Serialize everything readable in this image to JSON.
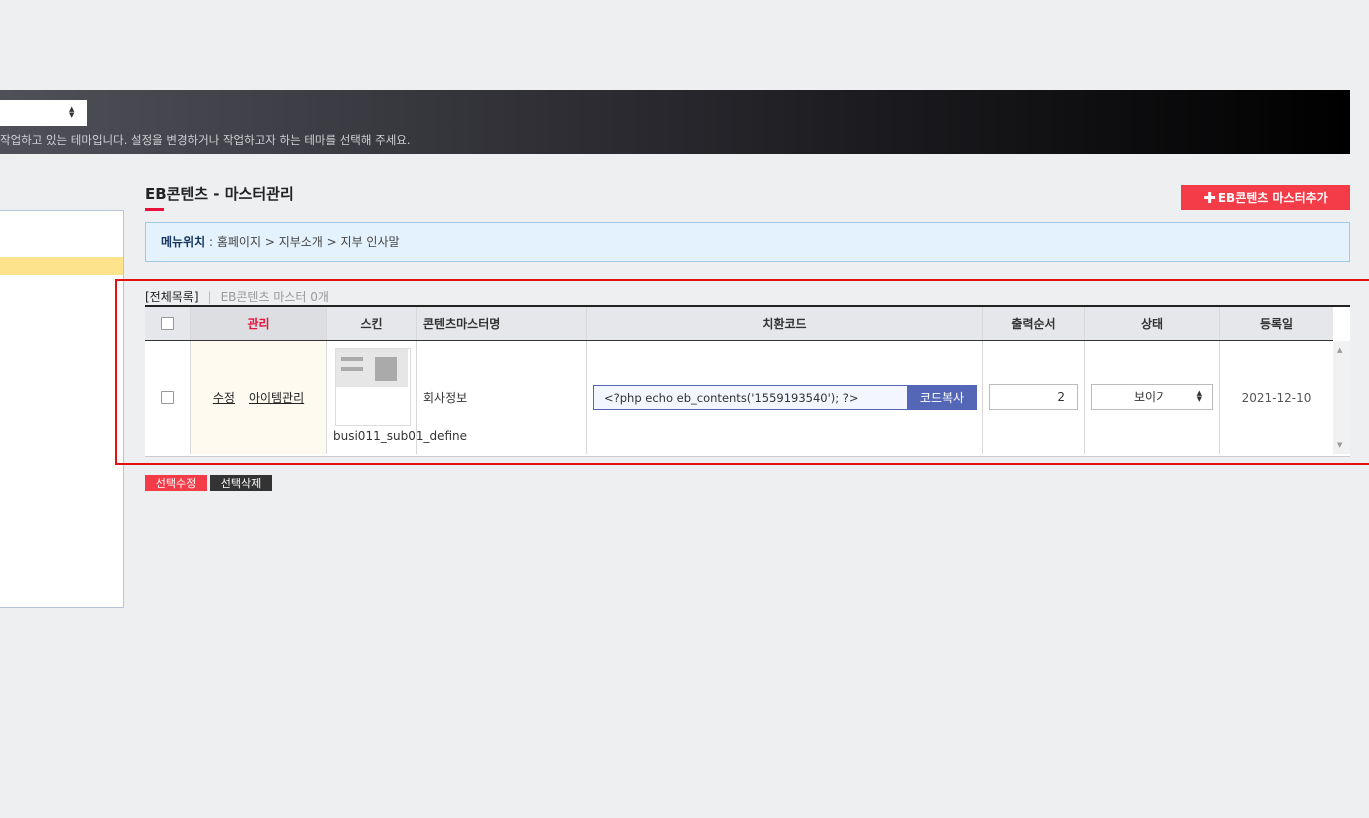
{
  "theme_bar": {
    "description": "작업하고 있는 테마입니다. 설정을 변경하거나 작업하고자 하는 테마를 선택해 주세요."
  },
  "page": {
    "title": "EB콘텐츠 - 마스터관리",
    "add_button": "EB콘텐츠 마스터추가"
  },
  "location": {
    "label": "메뉴위치",
    "path": " : 홈페이지 > 지부소개 > 지부 인사말"
  },
  "list": {
    "all_label": "[전체목록]",
    "count_label": "EB콘텐츠 마스터 0개"
  },
  "table": {
    "headers": [
      "관리",
      "스킨",
      "콘텐츠마스터명",
      "치환코드",
      "출력순서",
      "상태",
      "등록일"
    ],
    "rows": [
      {
        "edit": "수정",
        "item_manage": "아이템관리",
        "skin": "busi011_sub01_define",
        "name": "회사정보",
        "code": "<?php echo eb_contents('1559193540'); ?>",
        "copy_button": "코드복사",
        "order": "2",
        "status": "보이기",
        "date": "2021-12-10"
      }
    ]
  },
  "actions": {
    "modify_selected": "선택수정",
    "delete_selected": "선택삭제"
  },
  "colors": {
    "accent_red": "#f43b48",
    "copy_button": "#5467b7",
    "highlight_box": "#e31212"
  }
}
